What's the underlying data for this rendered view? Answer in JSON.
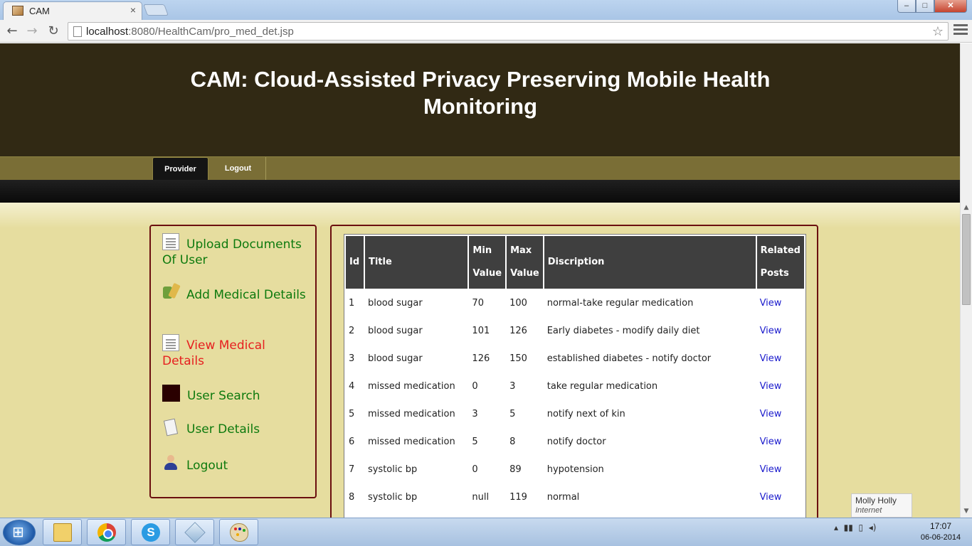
{
  "browser": {
    "tab_title": "CAM",
    "tab_close": "×",
    "url_host": "localhost",
    "url_path": ":8080/HealthCam/pro_med_det.jsp",
    "back_glyph": "←",
    "forward_glyph": "→",
    "reload_glyph": "↻",
    "star_glyph": "☆"
  },
  "window": {
    "minimize": "–",
    "maximize": "□",
    "close": "✕"
  },
  "header": {
    "title_line1": "CAM: Cloud-Assisted Privacy Preserving Mobile Health",
    "title_line2": "Monitoring"
  },
  "menu": {
    "provider": "Provider",
    "logout": "Logout"
  },
  "sidebar": {
    "items": [
      {
        "label": "Upload Documents Of User",
        "icon": "document-icon"
      },
      {
        "label": "Add Medical Details",
        "icon": "medicine-icon"
      },
      {
        "label": "View Medical Details",
        "icon": "document-icon",
        "active": true
      },
      {
        "label": "User Search",
        "icon": "user-search-icon"
      },
      {
        "label": "User Details",
        "icon": "clipboard-icon"
      },
      {
        "label": "Logout",
        "icon": "user-icon"
      }
    ]
  },
  "table": {
    "headers": [
      "Id",
      "Title",
      "Min Value",
      "Max Value",
      "Discription",
      "Related Posts"
    ],
    "rows": [
      {
        "id": "1",
        "title": "blood sugar",
        "min": "70",
        "max": "100",
        "desc": "normal-take regular medication",
        "link": "View"
      },
      {
        "id": "2",
        "title": "blood sugar",
        "min": "101",
        "max": "126",
        "desc": "Early diabetes - modify daily diet",
        "link": "View"
      },
      {
        "id": "3",
        "title": "blood sugar",
        "min": "126",
        "max": "150",
        "desc": "established diabetes - notify doctor",
        "link": "View"
      },
      {
        "id": "4",
        "title": "missed medication",
        "min": "0",
        "max": "3",
        "desc": "take regular medication",
        "link": "View"
      },
      {
        "id": "5",
        "title": "missed medication",
        "min": "3",
        "max": "5",
        "desc": "notify next of kin",
        "link": "View"
      },
      {
        "id": "6",
        "title": "missed medication",
        "min": "5",
        "max": "8",
        "desc": "notify doctor",
        "link": "View"
      },
      {
        "id": "7",
        "title": "systolic bp",
        "min": "0",
        "max": "89",
        "desc": "hypotension",
        "link": "View"
      },
      {
        "id": "8",
        "title": "systolic bp",
        "min": "null",
        "max": "119",
        "desc": "normal",
        "link": "View"
      }
    ]
  },
  "profile_popup": {
    "name": "Molly Holly",
    "subtitle": "Internet access"
  },
  "taskbar": {
    "apps": [
      "explorer",
      "chrome",
      "skype",
      "virtualbox",
      "paint"
    ],
    "time": "17:07",
    "date": "06-06-2014"
  },
  "colors": {
    "header_bg": "#312914",
    "menubar_bg": "#7a6e36",
    "page_bg": "#e6dd9f",
    "panel_border": "#6b0f0f",
    "link_green": "#0e7a0e",
    "link_active": "#e61f1f",
    "table_header_bg": "#3f3f3f"
  }
}
